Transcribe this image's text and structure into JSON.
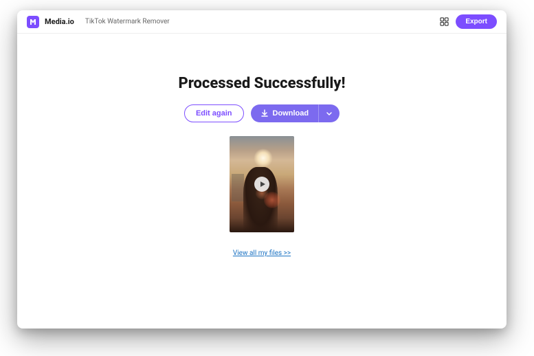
{
  "header": {
    "brand": "Media.io",
    "tool": "TikTok Watermark Remover",
    "export_label": "Export"
  },
  "main": {
    "title": "Processed Successfully!",
    "edit_label": "Edit again",
    "download_label": "Download",
    "view_files_label": "View all my files >>"
  },
  "colors": {
    "accent": "#7c4dff",
    "accent_light": "#7c6aef"
  }
}
